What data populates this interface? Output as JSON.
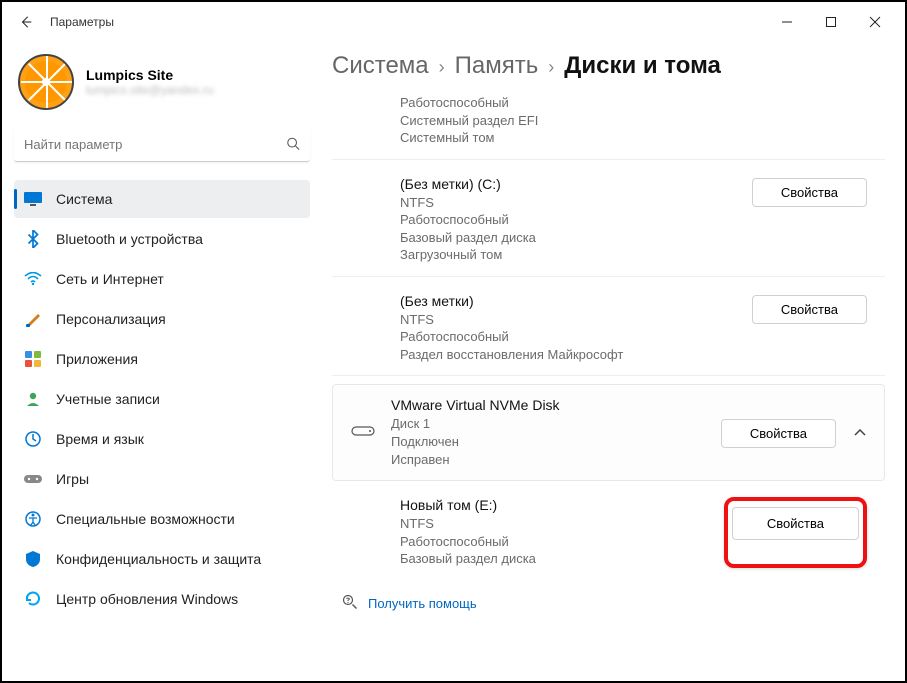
{
  "window": {
    "title": "Параметры"
  },
  "profile": {
    "name": "Lumpics Site",
    "email": "lumpics.site@yandex.ru"
  },
  "search": {
    "placeholder": "Найти параметр"
  },
  "sidebar": {
    "items": [
      {
        "label": "Система"
      },
      {
        "label": "Bluetooth и устройства"
      },
      {
        "label": "Сеть и Интернет"
      },
      {
        "label": "Персонализация"
      },
      {
        "label": "Приложения"
      },
      {
        "label": "Учетные записи"
      },
      {
        "label": "Время и язык"
      },
      {
        "label": "Игры"
      },
      {
        "label": "Специальные возможности"
      },
      {
        "label": "Конфиденциальность и защита"
      },
      {
        "label": "Центр обновления Windows"
      }
    ]
  },
  "breadcrumb": {
    "l1": "Система",
    "l2": "Память",
    "current": "Диски и тома"
  },
  "volumes": [
    {
      "title": "",
      "meta": "Работоспособный\nСистемный раздел EFI\nСистемный том"
    },
    {
      "title": "(Без метки) (C:)",
      "meta": "NTFS\nРаботоспособный\nБазовый раздел диска\nЗагрузочный том",
      "button": "Свойства"
    },
    {
      "title": "(Без метки)",
      "meta": "NTFS\nРаботоспособный\nРаздел восстановления Майкрософт",
      "button": "Свойства"
    }
  ],
  "disk": {
    "title": "VMware Virtual NVMe Disk",
    "meta": "Диск 1\nПодключен\nИсправен",
    "button": "Свойства"
  },
  "newvol": {
    "title": "Новый том (E:)",
    "meta": "NTFS\nРаботоспособный\nБазовый раздел диска",
    "button": "Свойства"
  },
  "help": {
    "label": "Получить помощь"
  }
}
